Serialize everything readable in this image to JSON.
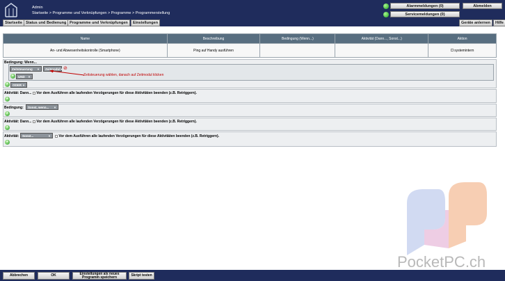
{
  "header": {
    "user": "Admin",
    "breadcrumb": "Startseite > Programme und Verknüpfungen > Programme > Programmerstellung",
    "alarm_label": "Alarmmeldungen (0)",
    "service_label": "Servicemeldungen (0)",
    "logout_label": "Abmelden",
    "nav": [
      "Startseite",
      "Status und Bedienung",
      "Programme und Verknüpfungen",
      "Einstellungen"
    ],
    "teach_label": "Geräte anlernen",
    "help_label": "Hilfe"
  },
  "table": {
    "headers": [
      "Name",
      "Beschreibung",
      "Bedingung (Wenn...)",
      "Aktivität (Dann..., Sonst...)",
      "Aktion"
    ],
    "row": {
      "name": "An- und Abwesenheitskontrolle (Smartphone)",
      "description": "Ping auf Handy ausführen",
      "condition": "",
      "activity": "",
      "action": "systemintern"
    }
  },
  "condition1": {
    "label": "Bedingung: Wenn...",
    "select1": "Zeitsteuerung",
    "select2": "Zeitmodul",
    "operator": "UND",
    "or_label": "ODER",
    "annotation": "Zeitsteuerung wählen, danach auf Zeitmodul klicken"
  },
  "activity1": {
    "label": "Aktivität: Dann...",
    "checkbox_text": "Vor dem Ausführen alle laufenden Verzögerungen für diese Aktivitäten beenden (z.B. Retriggern)."
  },
  "condition2": {
    "label": "Bedingung:",
    "select": "Sonst, wenn..."
  },
  "activity2": {
    "label": "Aktivität: Dann...",
    "checkbox_text": "Vor dem Ausführen alle laufenden Verzögerungen für diese Aktivitäten beenden (z.B. Retriggern)."
  },
  "activity3": {
    "label": "Aktivität:",
    "select": "Sonst...",
    "checkbox_text": "Vor dem Ausführen alle laufenden Verzögerungen für diese Aktivitäten beenden (z.B. Retriggern)."
  },
  "footer": {
    "cancel": "Abbrechen",
    "ok": "OK",
    "save_new": "Einstellungen als neues Programm speichern",
    "test": "Skript testen"
  },
  "watermark": "PocketPC.ch"
}
